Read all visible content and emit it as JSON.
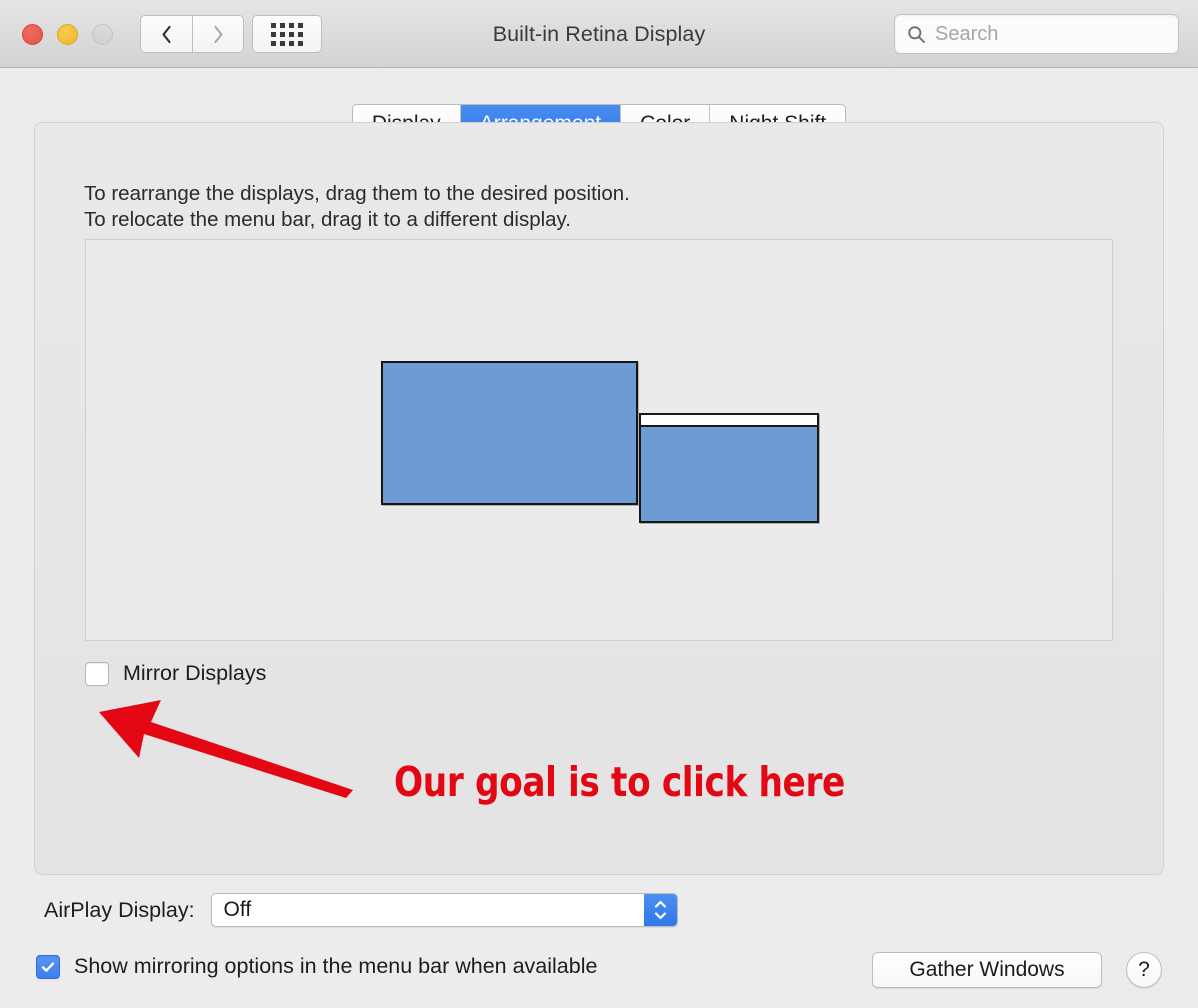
{
  "window": {
    "title": "Built-in Retina Display",
    "traffic_lights": [
      "close",
      "minimize",
      "zoom"
    ],
    "nav": {
      "back": "back-chevron",
      "forward": "forward-chevron",
      "show_all": "grid-icon"
    }
  },
  "search": {
    "placeholder": "Search",
    "value": "",
    "icon": "search-icon"
  },
  "tabs": [
    {
      "label": "Display",
      "selected": false
    },
    {
      "label": "Arrangement",
      "selected": true
    },
    {
      "label": "Color",
      "selected": false
    },
    {
      "label": "Night Shift",
      "selected": false
    }
  ],
  "instructions": {
    "line1": "To rearrange the displays, drag them to the desired position.",
    "line2": "To relocate the menu bar, drag it to a different display."
  },
  "arrangement": {
    "displays": [
      {
        "name": "main-display",
        "has_menu_bar": false
      },
      {
        "name": "secondary-display",
        "has_menu_bar": true
      }
    ]
  },
  "mirror": {
    "label": "Mirror Displays",
    "checked": false
  },
  "annotation": {
    "text": "Our goal is to click here",
    "color": "#e30613",
    "arrow": "red-arrow-pointing-up-left"
  },
  "airplay": {
    "label": "AirPlay Display:",
    "value": "Off",
    "options": [
      "Off"
    ]
  },
  "show_mirroring": {
    "label": "Show mirroring options in the menu bar when available",
    "checked": true
  },
  "buttons": {
    "gather_windows": "Gather Windows",
    "help": "?"
  },
  "colors": {
    "accent": "#2f78e8",
    "display_fill": "#6d9cd4",
    "annotation_red": "#e30613",
    "window_bg": "#ececec"
  }
}
